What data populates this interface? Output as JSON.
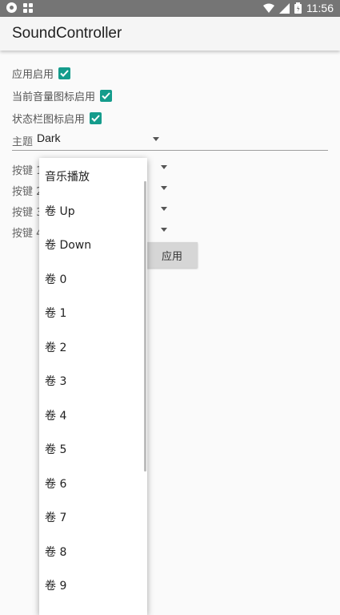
{
  "status_bar": {
    "time": "11:56"
  },
  "app": {
    "title": "SoundController"
  },
  "settings": {
    "app_enabled": {
      "label": "应用启用",
      "checked": true
    },
    "volume_icon_enabled": {
      "label": "当前音量图标启用",
      "checked": true
    },
    "statusbar_icon_enabled": {
      "label": "状态栏图标启用",
      "checked": true
    },
    "theme": {
      "label": "主题",
      "value": "Dark"
    },
    "keys": [
      {
        "label": "按键 1"
      },
      {
        "label": "按键 2"
      },
      {
        "label": "按键 3"
      },
      {
        "label": "按键 4"
      }
    ],
    "apply_button": "应用"
  },
  "dropdown": {
    "options": [
      "音乐播放",
      "卷 Up",
      "卷 Down",
      "卷 0",
      "卷 1",
      "卷 2",
      "卷 3",
      "卷 4",
      "卷 5",
      "卷 6",
      "卷 7",
      "卷 8",
      "卷 9"
    ]
  },
  "colors": {
    "checkbox": "#159c8c",
    "statusbar": "#757575",
    "appbar": "#f5f5f5"
  }
}
